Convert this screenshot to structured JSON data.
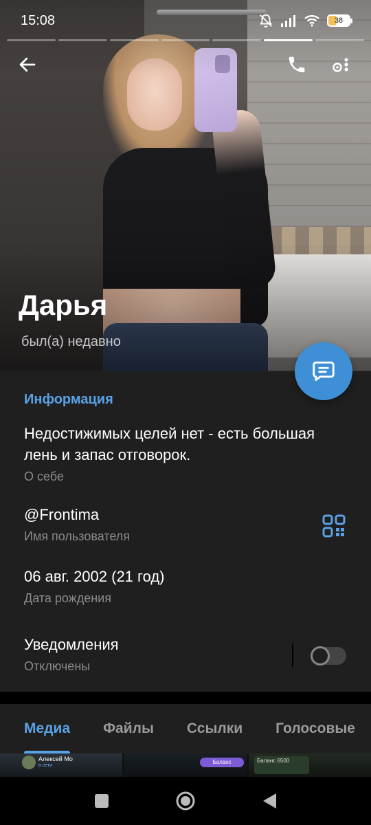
{
  "status_bar": {
    "time": "15:08",
    "battery": "38"
  },
  "profile": {
    "name": "Дарья",
    "status": "был(а) недавно"
  },
  "info": {
    "section_title": "Информация",
    "bio_value": "Недостижимых целей нет - есть большая лень и запас отговорок.",
    "bio_label": "О себе",
    "username_value": "@Frontima",
    "username_label": "Имя пользователя",
    "birthday_value": "06 авг. 2002 (21 год)",
    "birthday_label": "Дата рождения",
    "notifications_value": "Уведомления",
    "notifications_label": "Отключены",
    "notifications_enabled": false
  },
  "tabs": [
    {
      "label": "Медиа",
      "active": true
    },
    {
      "label": "Файлы",
      "active": false
    },
    {
      "label": "Ссылки",
      "active": false
    },
    {
      "label": "Голосовые",
      "active": false
    }
  ],
  "media_thumbs": {
    "thumb1_name": "Алексей Мо",
    "thumb1_sub": "в сети",
    "thumb2_chip": "Баланс",
    "thumb3_text": "Баланс 6500"
  },
  "icons": {
    "back": "arrow-left-icon",
    "call": "phone-icon",
    "more": "more-vertical-icon",
    "message": "message-icon",
    "qr": "qr-code-icon"
  },
  "colors": {
    "accent": "#5aa2e6",
    "fab": "#3f8fd6",
    "panel": "#1f1f1f"
  }
}
